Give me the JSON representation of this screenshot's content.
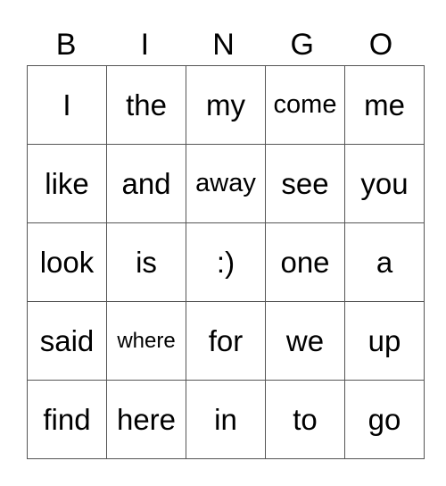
{
  "header": [
    "B",
    "I",
    "N",
    "G",
    "O"
  ],
  "rows": [
    [
      "I",
      "the",
      "my",
      "come",
      "me"
    ],
    [
      "like",
      "and",
      "away",
      "see",
      "you"
    ],
    [
      "look",
      "is",
      ":)",
      "one",
      "a"
    ],
    [
      "said",
      "where",
      "for",
      "we",
      "up"
    ],
    [
      "find",
      "here",
      "in",
      "to",
      "go"
    ]
  ]
}
